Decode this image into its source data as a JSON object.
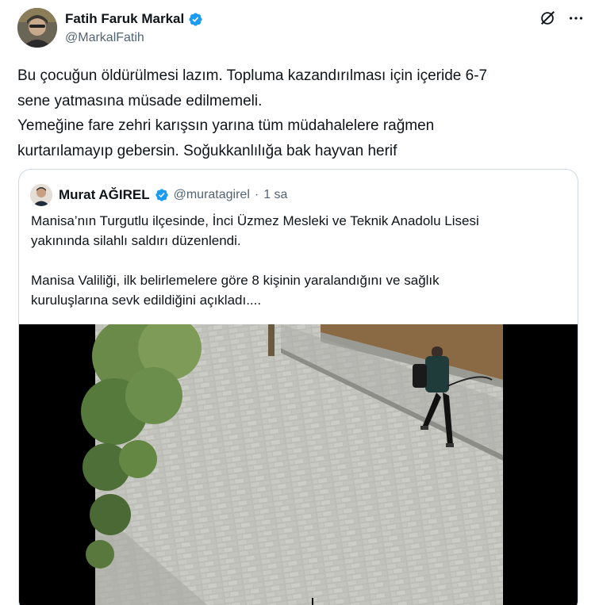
{
  "author": {
    "name": "Fatih Faruk Markal",
    "handle": "@MarkalFatih",
    "avatar_icon": "user-avatar",
    "verified_icon": "verified-badge-icon"
  },
  "tweet": {
    "lines": [
      "Bu çocuğun öldürülmesi lazım. Topluma kazandırılması için içeride 6-7",
      "sene yatmasına müsade edilmemeli.",
      "Yemeğine fare zehri karışsın yarına tüm müdahalelere rağmen",
      "kurtarılamayıp gebersin. Soğukkanlılığa bak hayvan herif"
    ]
  },
  "header_icons": [
    "grok-icon",
    "more-icon"
  ],
  "quote": {
    "name": "Murat AĞIREL",
    "handle": "@muratagirel",
    "dot": "·",
    "time": "1 sa",
    "para1": [
      "Manisa’nın Turgutlu ilçesinde, İnci Üzmez Mesleki ve Teknik Anadolu Lisesi",
      "yakınında silahlı saldırı düzenlendi."
    ],
    "para2": [
      "Manisa Valiliği, ilk belirlemelere göre 8 kişinin yaralandığını ve sağlık",
      "kuruluşlarına sevk edildiğini açıkladı...."
    ]
  },
  "colors": {
    "text": "#0f1419",
    "secondary": "#536471",
    "verified": "#1d9bf0",
    "border": "#cfd9de"
  }
}
